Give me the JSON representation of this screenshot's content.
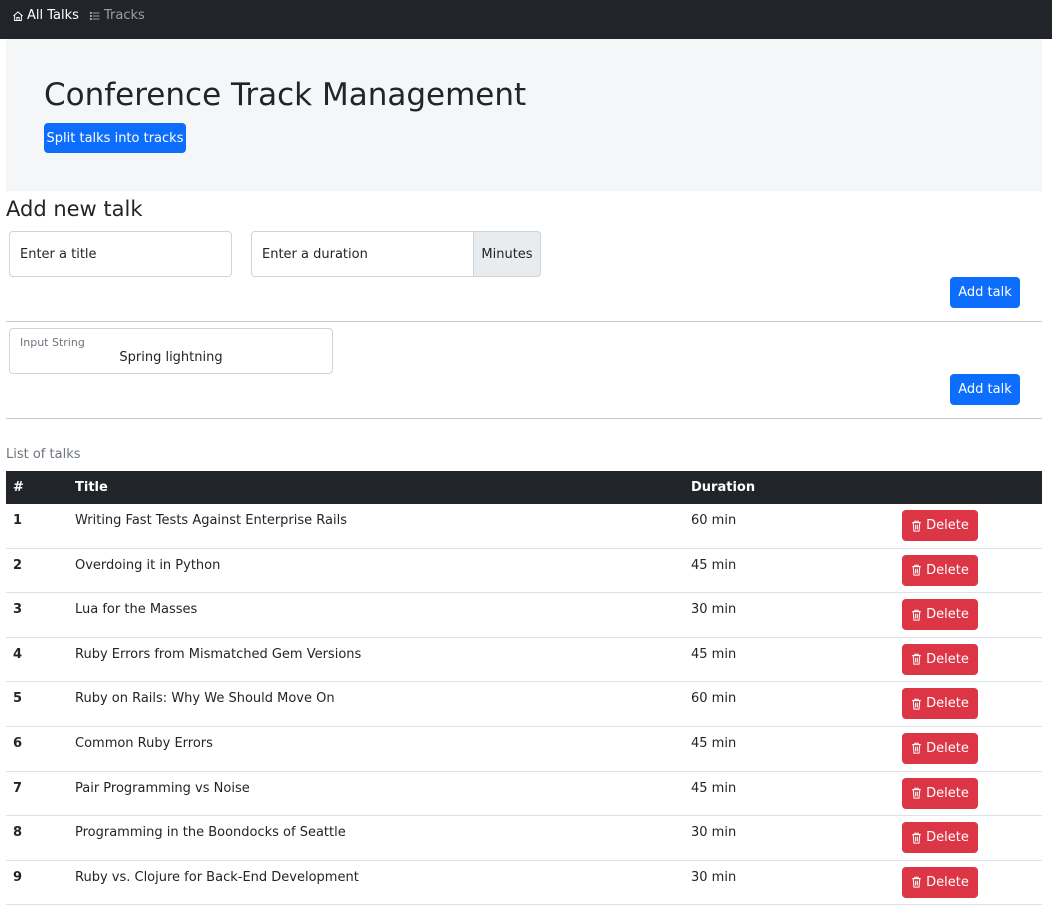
{
  "nav": {
    "items": [
      {
        "label": "All Talks",
        "icon": "home-icon",
        "active": true
      },
      {
        "label": "Tracks",
        "icon": "list-icon",
        "active": false
      }
    ]
  },
  "hero": {
    "title": "Conference Track Management",
    "split_button": "Split talks into tracks"
  },
  "add_talk": {
    "heading": "Add new talk",
    "title_placeholder": "Enter a title",
    "duration_placeholder": "Enter a duration",
    "duration_unit": "Minutes",
    "add_button": "Add talk",
    "input_string_label": "Input String",
    "input_string_value": "Spring lightning",
    "add_button_2": "Add talk"
  },
  "talks": {
    "caption": "List of talks",
    "columns": [
      "#",
      "Title",
      "Duration",
      ""
    ],
    "delete_label": "Delete",
    "rows": [
      {
        "num": "1",
        "title": "Writing Fast Tests Against Enterprise Rails",
        "duration": "60 min"
      },
      {
        "num": "2",
        "title": "Overdoing it in Python",
        "duration": "45 min"
      },
      {
        "num": "3",
        "title": "Lua for the Masses",
        "duration": "30 min"
      },
      {
        "num": "4",
        "title": "Ruby Errors from Mismatched Gem Versions",
        "duration": "45 min"
      },
      {
        "num": "5",
        "title": "Ruby on Rails: Why We Should Move On",
        "duration": "60 min"
      },
      {
        "num": "6",
        "title": "Common Ruby Errors",
        "duration": "45 min"
      },
      {
        "num": "7",
        "title": "Pair Programming vs Noise",
        "duration": "45 min"
      },
      {
        "num": "8",
        "title": "Programming in the Boondocks of Seattle",
        "duration": "30 min"
      },
      {
        "num": "9",
        "title": "Ruby vs. Clojure for Back-End Development",
        "duration": "30 min"
      }
    ]
  },
  "colors": {
    "navbar": "#212529",
    "primary": "#0d6efd",
    "danger": "#dc3545",
    "hero_bg": "#f5f6f8"
  }
}
